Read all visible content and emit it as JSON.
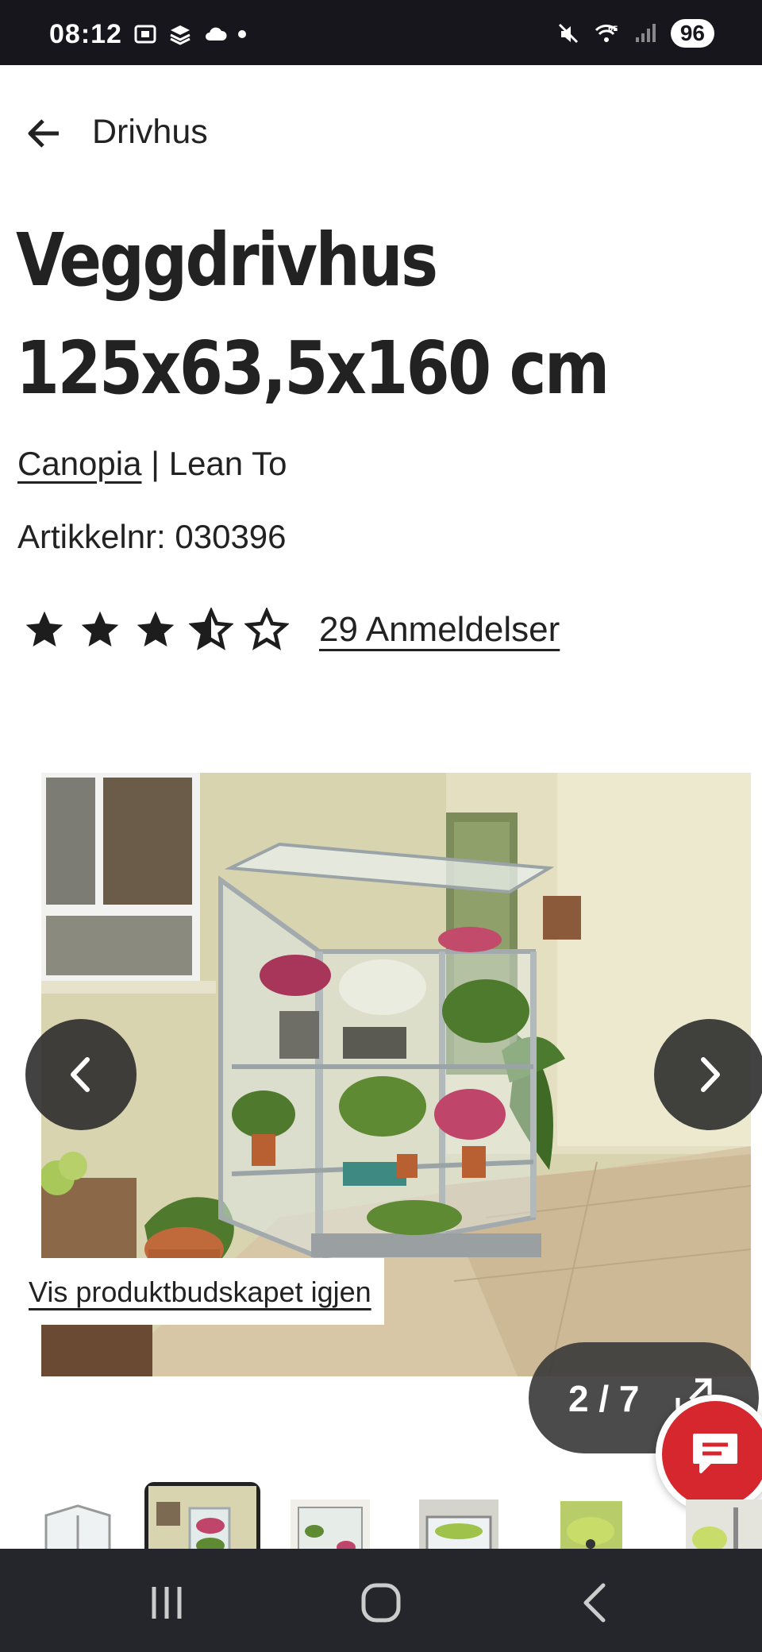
{
  "status_bar": {
    "time": "08:12",
    "battery": "96",
    "network_label": "6E",
    "left_icons": [
      "screenshot-icon",
      "stack-icon",
      "cloud-icon",
      "dot-icon"
    ],
    "right_icons": [
      "mute-icon",
      "wifi-icon",
      "signal-icon",
      "battery-icon"
    ]
  },
  "header": {
    "back_icon": "arrow-left-icon",
    "breadcrumb": "Drivhus"
  },
  "product": {
    "title_line1": "Veggdrivhus",
    "title_line2": "125x63,5x160 cm",
    "brand": "Canopia",
    "separator": " | ",
    "series": "Lean To",
    "sku_label": "Artikkelnr: 030396",
    "rating": 3.5,
    "rating_max": 5,
    "reviews_link": "29 Anmeldelser"
  },
  "gallery": {
    "message_link": "Vis produktbudskapet igjen",
    "counter": "2 / 7",
    "current_index": 2,
    "total": 7,
    "prev_icon": "chevron-left-icon",
    "next_icon": "chevron-right-icon",
    "expand_icon": "expand-icon",
    "chat_icon": "chat-icon"
  },
  "thumbnails": {
    "selected_index": 1,
    "items": [
      "thumb-greenhouse-white",
      "thumb-greenhouse-plants",
      "thumb-greenhouse-shelves",
      "thumb-greenhouse-top",
      "thumb-greenhouse-green",
      "thumb-greenhouse-partial"
    ]
  },
  "colors": {
    "chat_button": "#d6262e",
    "status_bar": "#16161c",
    "nav_bar": "#25262b",
    "text": "#222222"
  }
}
